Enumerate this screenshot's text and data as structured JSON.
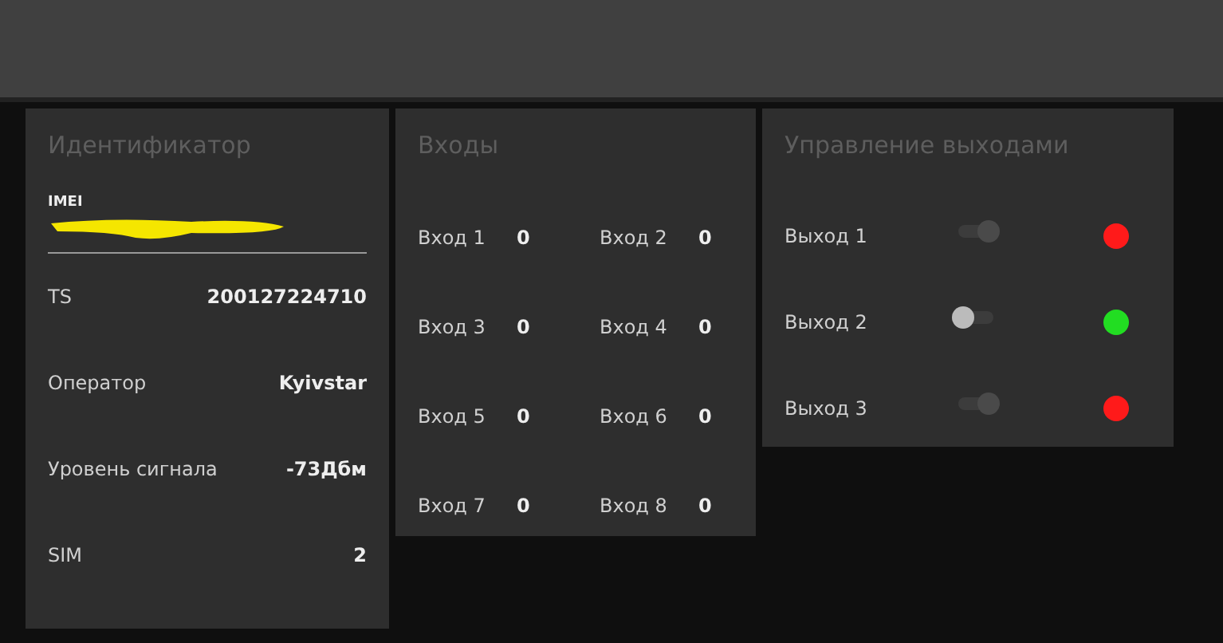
{
  "identifier": {
    "title": "Идентификатор",
    "imei": {
      "label": "IMEI",
      "redacted": true
    },
    "rows": [
      {
        "label": "TS",
        "value": "200127224710"
      },
      {
        "label": "Оператор",
        "value": "Kyivstar"
      },
      {
        "label": "Уровень сигнала",
        "value": "-73Дбм"
      },
      {
        "label": "SIM",
        "value": "2"
      }
    ]
  },
  "inputs": {
    "title": "Входы",
    "items": [
      {
        "label": "Вход 1",
        "value": "0"
      },
      {
        "label": "Вход 2",
        "value": "0"
      },
      {
        "label": "Вход 3",
        "value": "0"
      },
      {
        "label": "Вход 4",
        "value": "0"
      },
      {
        "label": "Вход 5",
        "value": "0"
      },
      {
        "label": "Вход 6",
        "value": "0"
      },
      {
        "label": "Вход 7",
        "value": "0"
      },
      {
        "label": "Вход 8",
        "value": "0"
      }
    ]
  },
  "outputs": {
    "title": "Управление выходами",
    "items": [
      {
        "label": "Выход 1",
        "on": true,
        "color": "#ff1a1a"
      },
      {
        "label": "Выход 2",
        "on": false,
        "color": "#22dd22"
      },
      {
        "label": "Выход 3",
        "on": true,
        "color": "#ff1a1a"
      }
    ]
  }
}
